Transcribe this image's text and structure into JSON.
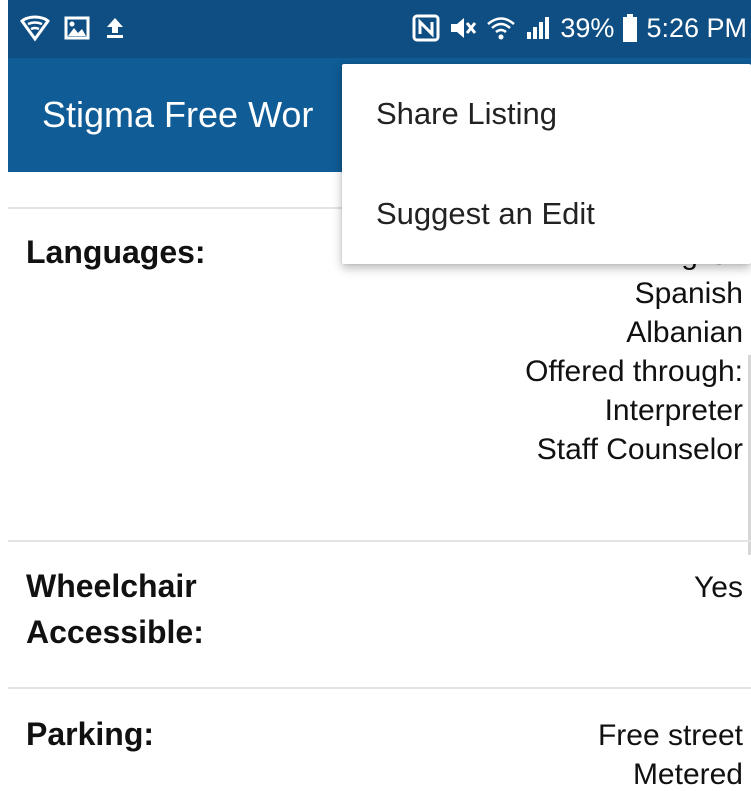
{
  "status_bar": {
    "battery_percent": "39%",
    "time": "5:26 PM",
    "icons_left": [
      "shield-icon",
      "image-icon",
      "upload-icon"
    ],
    "icons_right": [
      "nfc-icon",
      "mute-icon",
      "wifi-icon",
      "signal-icon",
      "battery-icon"
    ]
  },
  "app_bar": {
    "title": "Stigma Free Wor"
  },
  "overflow_menu": {
    "items": [
      {
        "label": "Share Listing"
      },
      {
        "label": "Suggest an Edit"
      }
    ]
  },
  "details": {
    "languages": {
      "label": "Languages:",
      "values": [
        "English",
        "Spanish",
        "Albanian",
        "Offered through:",
        "Interpreter",
        "Staff Counselor"
      ]
    },
    "wheelchair": {
      "label_line1": "Wheelchair",
      "label_line2": "Accessible:",
      "value": "Yes"
    },
    "parking": {
      "label": "Parking:",
      "values": [
        "Free street",
        "Metered"
      ]
    }
  },
  "colors": {
    "status_bar": "#0f4e82",
    "app_bar": "#0f5c96"
  }
}
